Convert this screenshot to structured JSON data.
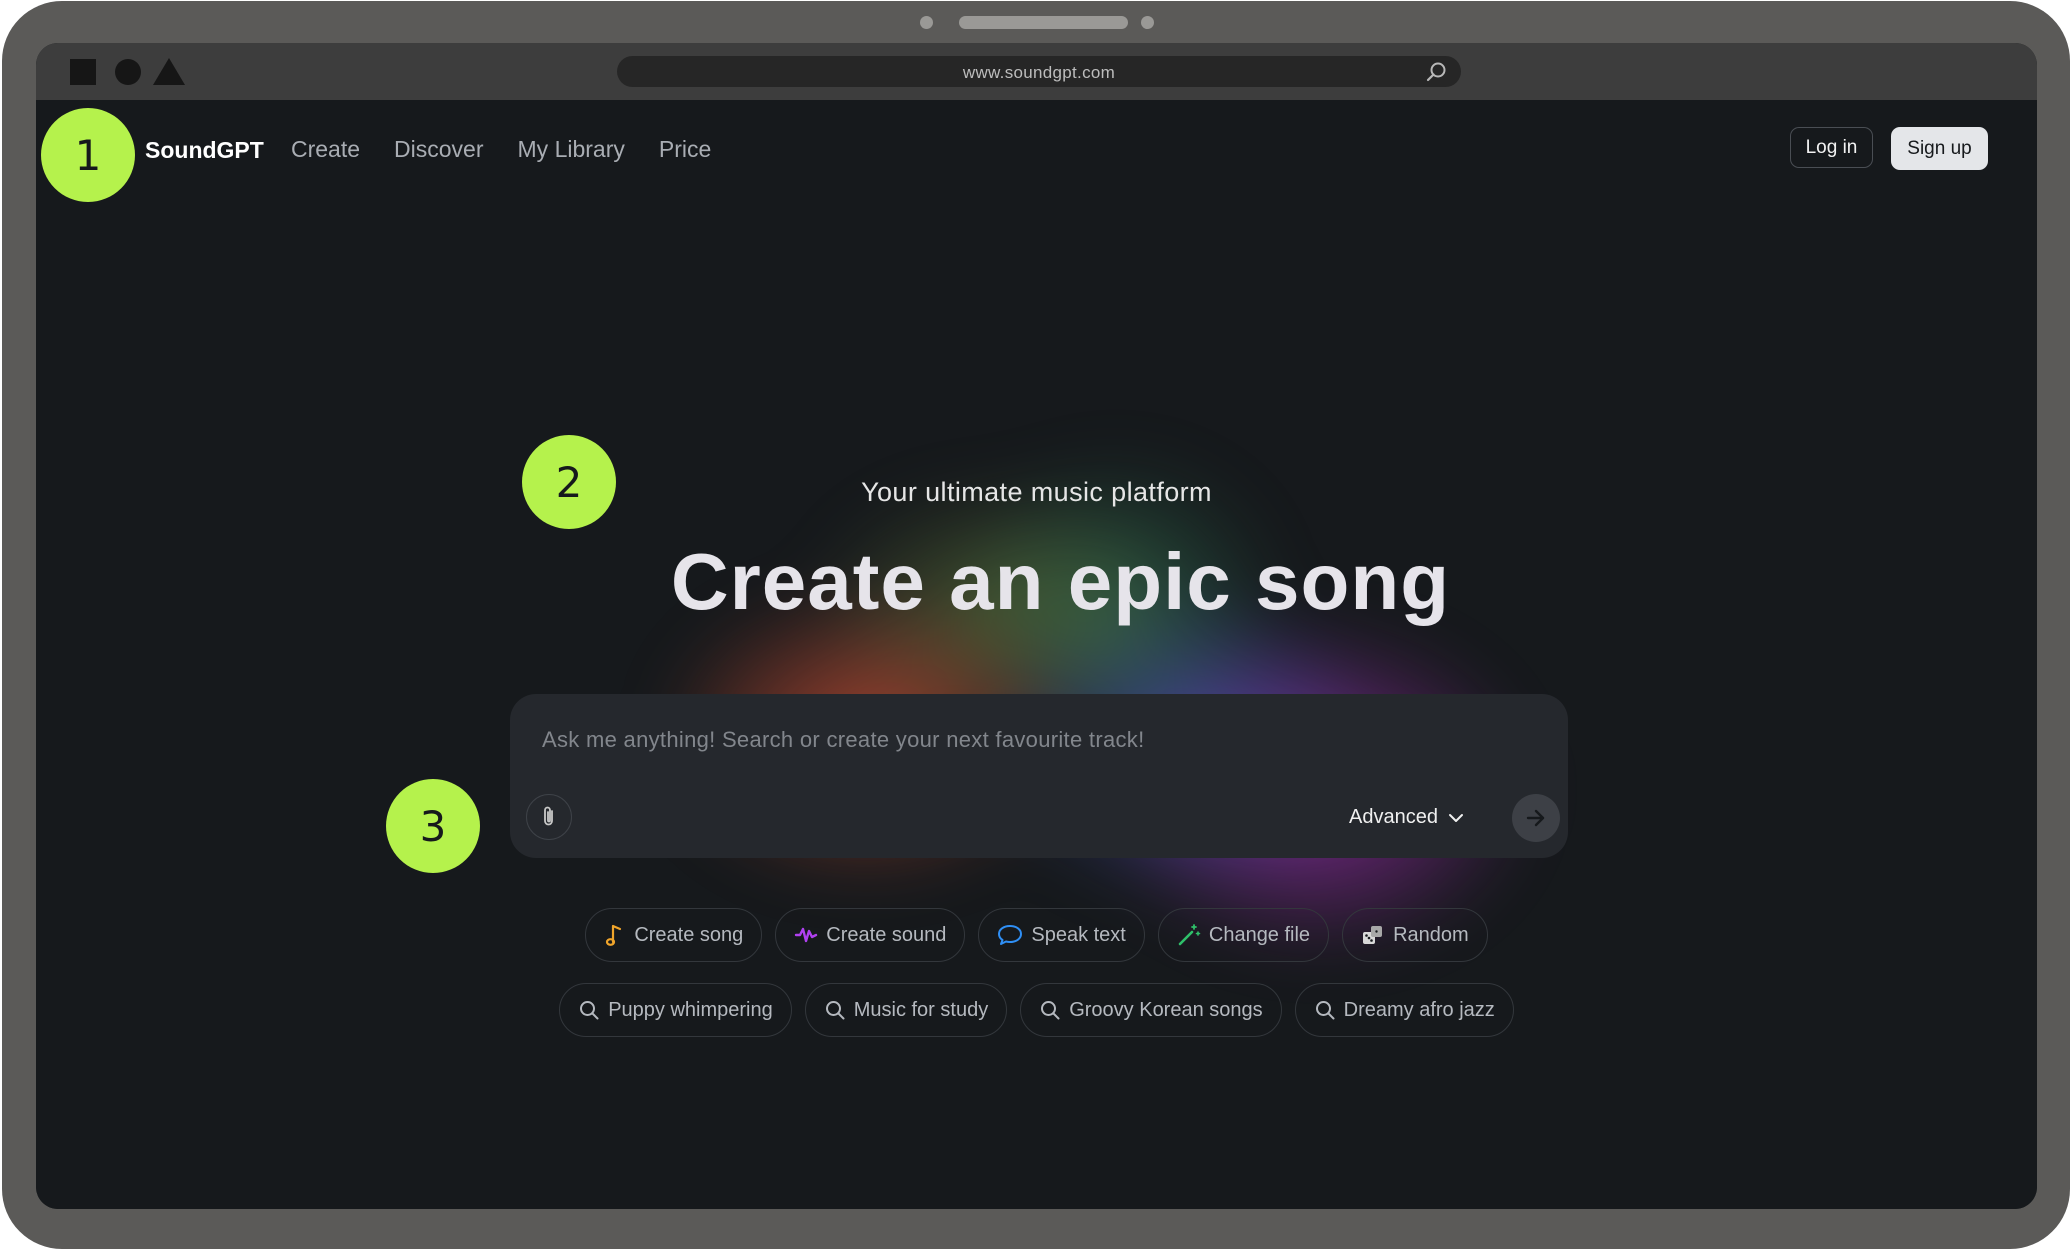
{
  "browser": {
    "url": "www.soundgpt.com"
  },
  "nav": {
    "logo": "SoundGPT",
    "links": [
      "Create",
      "Discover",
      "My Library",
      "Price"
    ],
    "login_label": "Log in",
    "signup_label": "Sign up"
  },
  "hero": {
    "tagline": "Your ultimate music platform",
    "headline": "Create an epic song"
  },
  "prompt": {
    "placeholder": "Ask me anything! Search or create your next favourite track!",
    "advanced_label": "Advanced"
  },
  "actions": [
    {
      "label": "Create song",
      "icon": "music-note-icon",
      "color": "#f0a52b"
    },
    {
      "label": "Create sound",
      "icon": "waveform-icon",
      "color": "#b040f0"
    },
    {
      "label": "Speak text",
      "icon": "speech-bubble-icon",
      "color": "#2f8ff5"
    },
    {
      "label": "Change file",
      "icon": "magic-wand-icon",
      "color": "#2fc06a"
    },
    {
      "label": "Random",
      "icon": "dice-icon",
      "color": "#d8d8d8"
    }
  ],
  "suggestions": [
    {
      "label": "Puppy whimpering",
      "icon": "search-icon"
    },
    {
      "label": "Music for study",
      "icon": "search-icon"
    },
    {
      "label": "Groovy Korean songs",
      "icon": "search-icon"
    },
    {
      "label": "Dreamy afro jazz",
      "icon": "search-icon"
    }
  ],
  "markers": [
    "1",
    "2",
    "3"
  ],
  "colors": {
    "background": "#16191c",
    "marker": "#b5f24c",
    "device_frame": "#5b5a58"
  }
}
